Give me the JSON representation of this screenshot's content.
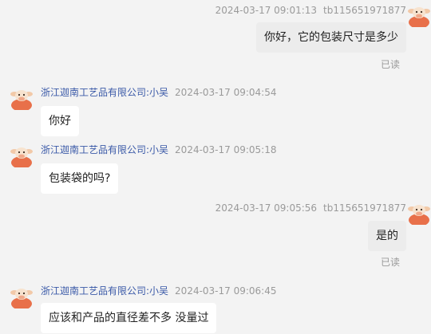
{
  "messages": [
    {
      "side": "right",
      "time": "2024-03-17 09:01:13",
      "sender": "tb115651971877",
      "text": "你好，它的包装尺寸是多少",
      "status": "已读"
    },
    {
      "side": "left",
      "sender": "浙江迦南工艺品有限公司:小吴",
      "time": "2024-03-17 09:04:54",
      "text": "你好"
    },
    {
      "side": "left",
      "sender": "浙江迦南工艺品有限公司:小吴",
      "time": "2024-03-17 09:05:18",
      "text": "包装袋的吗?"
    },
    {
      "side": "right",
      "time": "2024-03-17 09:05:56",
      "sender": "tb115651971877",
      "text": "是的",
      "status": "已读"
    },
    {
      "side": "left",
      "sender": "浙江迦南工艺品有限公司:小吴",
      "time": "2024-03-17 09:06:45",
      "text": "应该和产品的直径差不多 没量过"
    }
  ],
  "avatar_icon": "cartoon-cow-avatar-icon",
  "colors": {
    "background": "#f3f3f3",
    "sender": "#3b5aa8",
    "meta": "#9a9a9a",
    "bubble": "#ffffff",
    "my_bubble": "#ececec",
    "avatar": "#e8704a"
  }
}
